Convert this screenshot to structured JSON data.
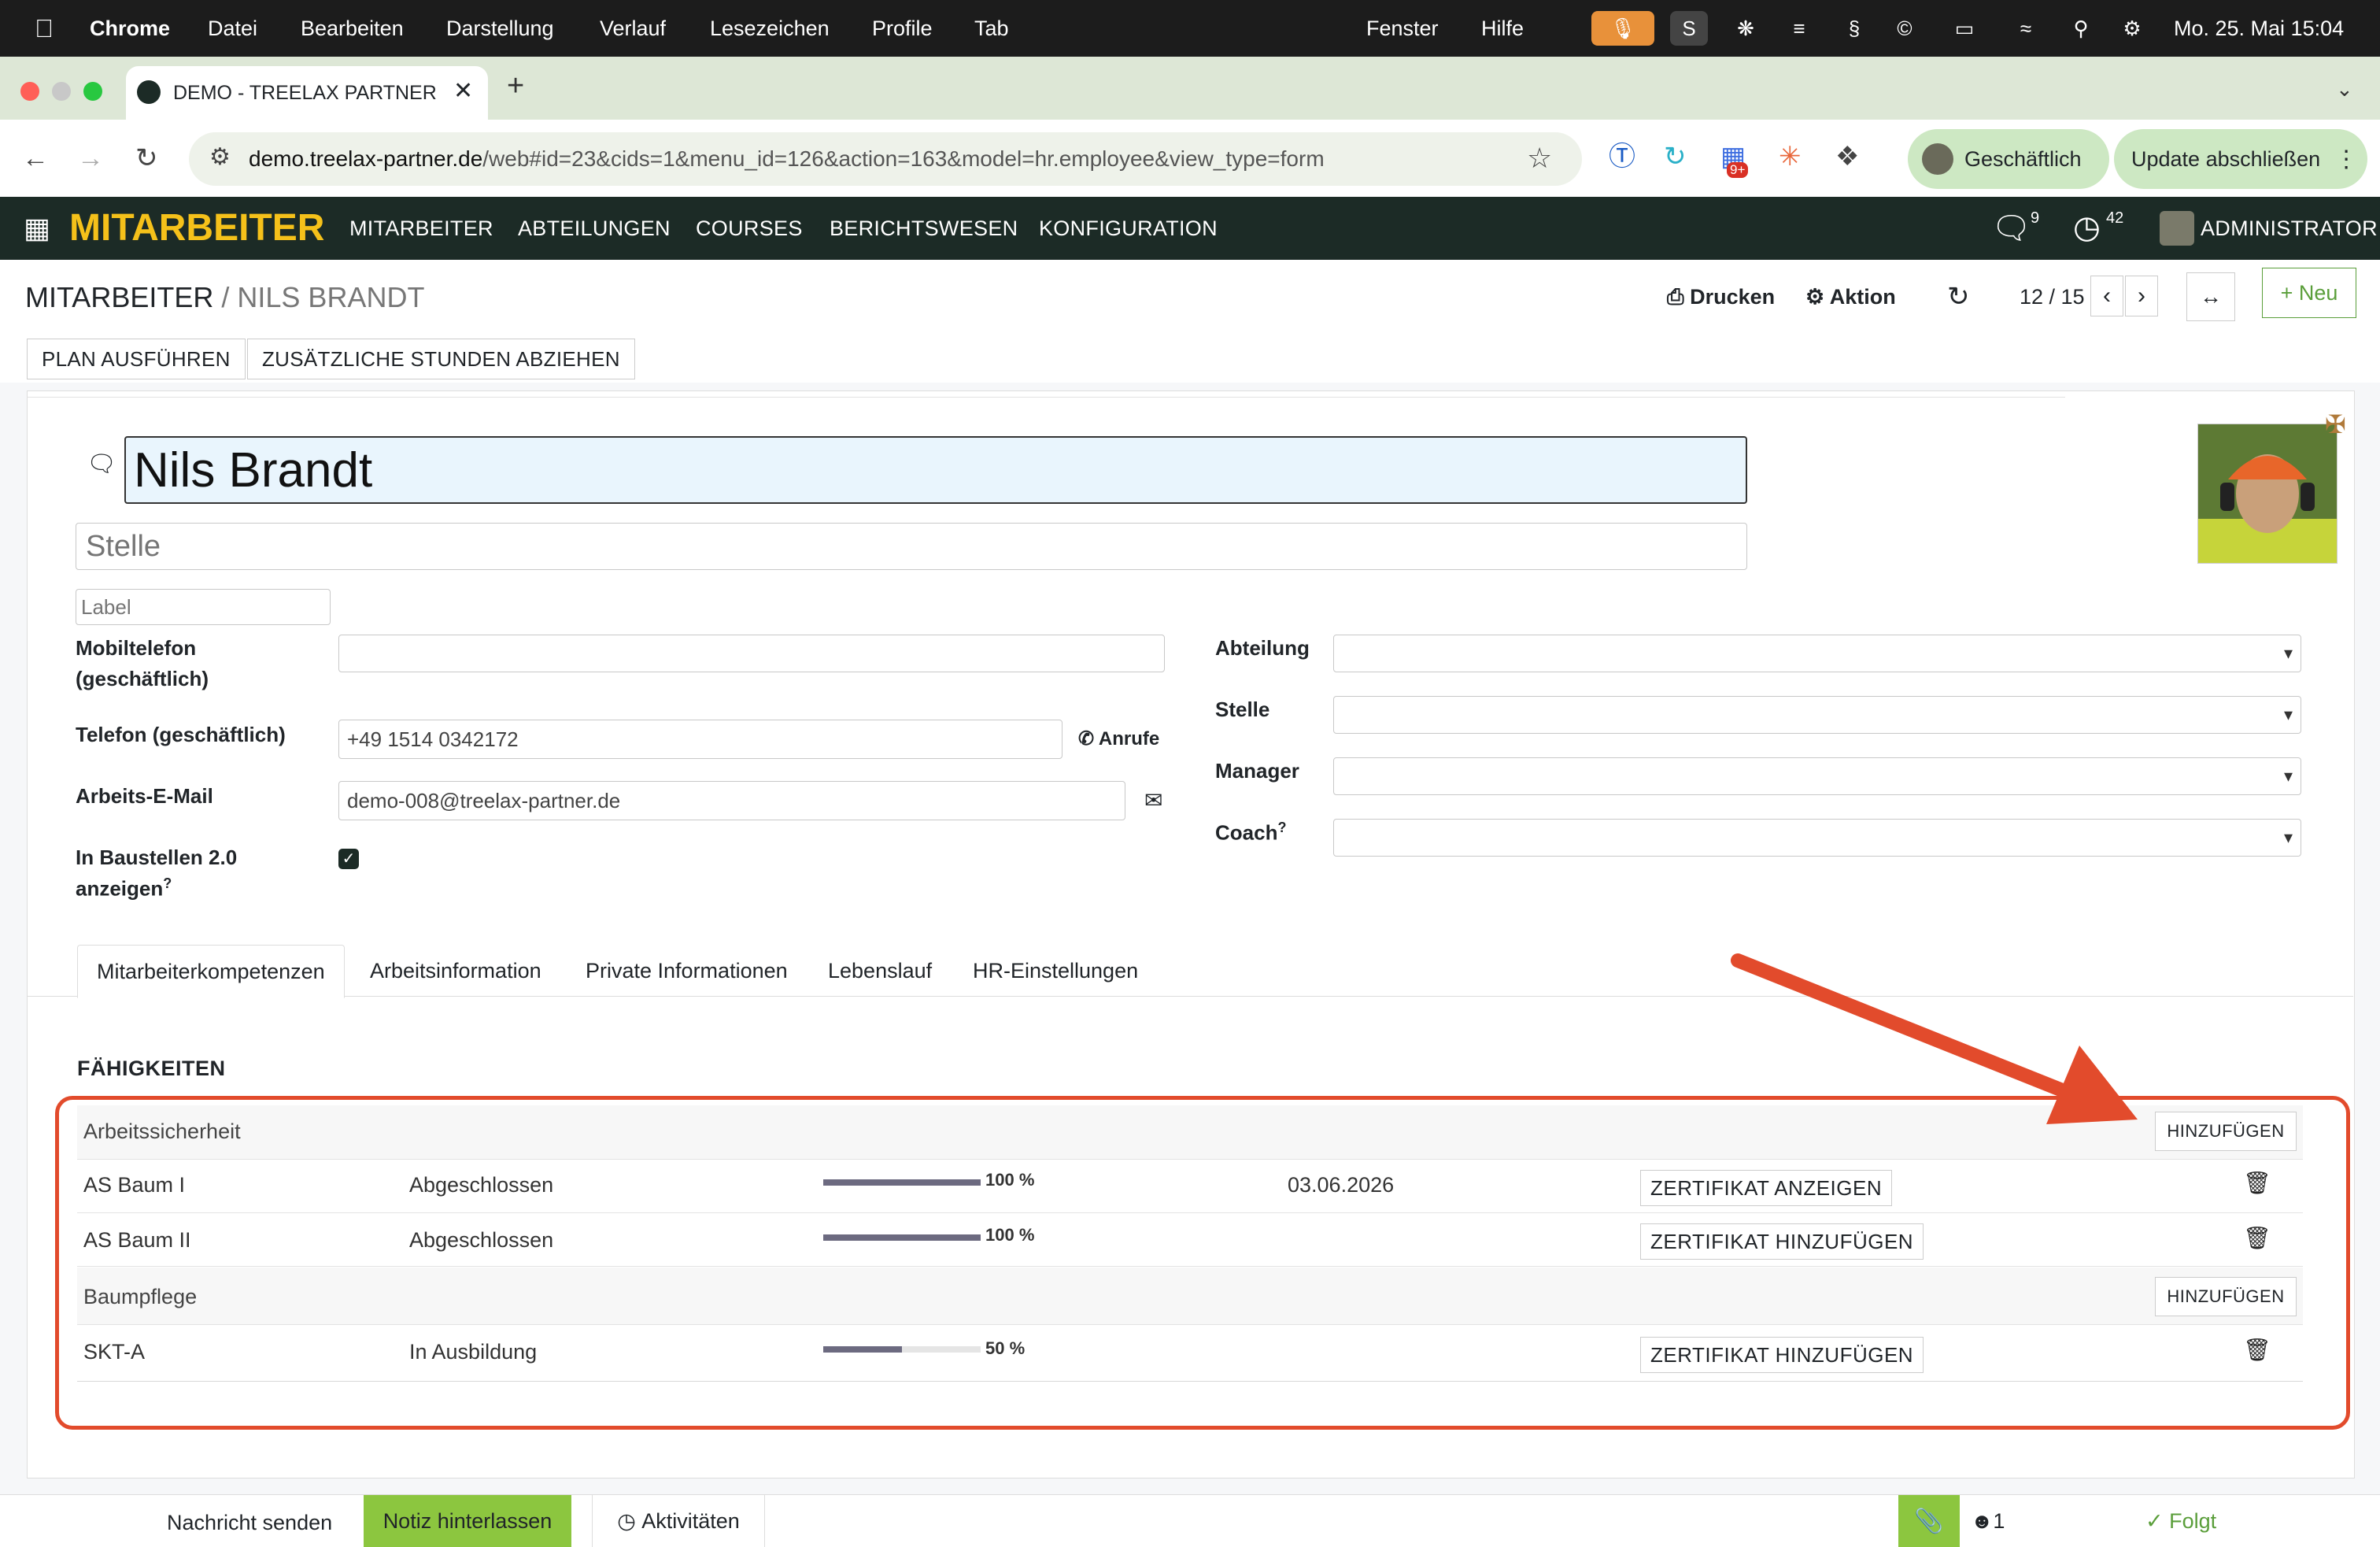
{
  "macos": {
    "app": "Chrome",
    "menu": [
      "Datei",
      "Bearbeiten",
      "Darstellung",
      "Verlauf",
      "Lesezeichen",
      "Profile",
      "Tab"
    ],
    "menu_right": [
      "Fenster",
      "Hilfe"
    ],
    "tray_s": "S",
    "clock": "Mo. 25. Mai  15:04"
  },
  "browser": {
    "tab_title": "DEMO - TREELAX PARTNER -",
    "new_tab": "+",
    "url_host": "demo.treelax-partner.de",
    "url_path": "/web#id=23&cids=1&menu_id=126&action=163&model=hr.employee&view_type=form",
    "ext_badge": "9+",
    "profile_label": "Geschäftlich",
    "update_label": "Update abschließen"
  },
  "odoo": {
    "app_title": "MITARBEITER",
    "menu": [
      "MITARBEITER",
      "ABTEILUNGEN",
      "COURSES",
      "BERICHTSWESEN",
      "KONFIGURATION"
    ],
    "messages_count": "9",
    "activities_count": "42",
    "user": "ADMINISTRATOR"
  },
  "control_panel": {
    "breadcrumb_parent": "MITARBEITER",
    "breadcrumb_sep": "/",
    "breadcrumb_current": "NILS BRANDT",
    "print_label": "Drucken",
    "action_label": "Aktion",
    "pager": "12 / 15",
    "new_label": "Neu"
  },
  "header_buttons": [
    "PLAN AUSFÜHREN",
    "ZUSÄTZLICHE STUNDEN ABZIEHEN"
  ],
  "employee": {
    "name": "Nils Brandt",
    "job_title_placeholder": "Stelle",
    "label_placeholder": "Label",
    "left_fields": [
      {
        "label": "Mobiltelefon (geschäftlich)",
        "value": ""
      },
      {
        "label": "Telefon (geschäftlich)",
        "value": "+49 1514 0342172",
        "action": "Anrufe"
      },
      {
        "label": "Arbeits-E-Mail",
        "value": "demo-008@treelax-partner.de"
      },
      {
        "label": "In Baustellen 2.0 anzeigen",
        "help": "?",
        "checked": true
      }
    ],
    "right_fields": [
      {
        "label": "Abteilung",
        "value": ""
      },
      {
        "label": "Stelle",
        "value": ""
      },
      {
        "label": "Manager",
        "value": ""
      },
      {
        "label": "Coach",
        "help": "?",
        "value": ""
      }
    ]
  },
  "tabs": [
    "Mitarbeiterkompetenzen",
    "Arbeitsinformation",
    "Private Informationen",
    "Lebenslauf",
    "HR-Einstellungen"
  ],
  "skills": {
    "heading": "FÄHIGKEITEN",
    "add_label": "HINZUFÜGEN",
    "groups": [
      {
        "name": "Arbeitssicherheit",
        "rows": [
          {
            "skill": "AS Baum I",
            "level": "Abgeschlossen",
            "progress": 100,
            "progress_label": "100 %",
            "date": "03.06.2026",
            "cert": "ZERTIFIKAT ANZEIGEN"
          },
          {
            "skill": "AS Baum II",
            "level": "Abgeschlossen",
            "progress": 100,
            "progress_label": "100 %",
            "date": "",
            "cert": "ZERTIFIKAT HINZUFÜGEN"
          }
        ]
      },
      {
        "name": "Baumpflege",
        "rows": [
          {
            "skill": "SKT-A",
            "level": "In Ausbildung",
            "progress": 50,
            "progress_label": "50 %",
            "date": "",
            "cert": "ZERTIFIKAT HINZUFÜGEN"
          }
        ]
      }
    ]
  },
  "chatter": {
    "send_message": "Nachricht senden",
    "log_note": "Notiz hinterlassen",
    "activities": "Aktivitäten",
    "followers_count": "1",
    "follow": "Folgt"
  },
  "colors": {
    "odoo_nav": "#1c2b26",
    "brand_yellow": "#f5c11a",
    "annotation_red": "#e24b2c",
    "log_note_green": "#8cc63f"
  }
}
